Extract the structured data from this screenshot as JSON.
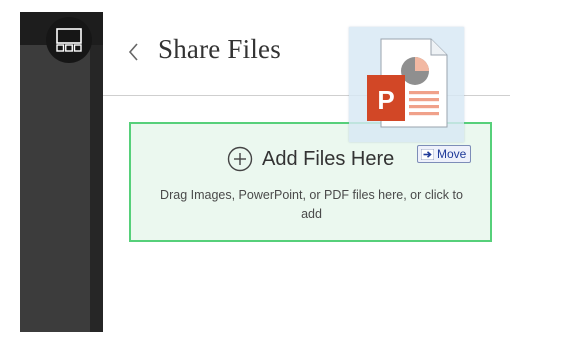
{
  "header": {
    "title": "Share Files",
    "back_icon": "chevron-left-icon"
  },
  "sidebar": {
    "layout_icon": "layout-grid-icon"
  },
  "dropzone": {
    "add_label": "Add Files Here",
    "add_icon": "plus-circle-icon",
    "hint": "Drag Images, PowerPoint, or PDF files here, or click to add"
  },
  "drag": {
    "move_label": "Move",
    "file_icon": "powerpoint-file-icon",
    "file_badge": "P"
  },
  "colors": {
    "rail": "#3c3c3c",
    "dropzone_border": "#56d07a",
    "dropzone_bg": "#ebf8ef",
    "powerpoint": "#d24726"
  }
}
